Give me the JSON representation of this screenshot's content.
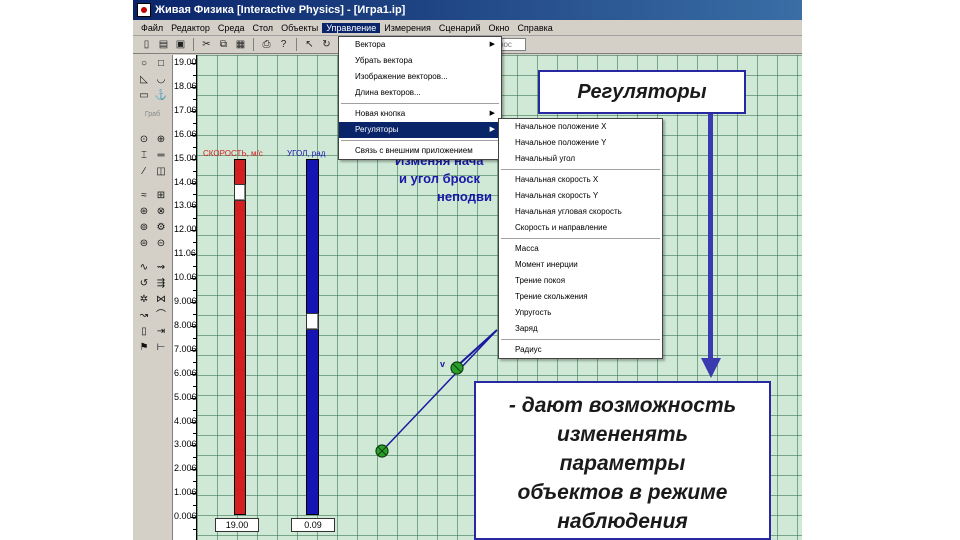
{
  "window": {
    "title": "Живая Физика [Interactive Physics] - [Игра1.ip]"
  },
  "menubar": [
    "Файл",
    "Редактор",
    "Среда",
    "Стол",
    "Объекты",
    "Управление",
    "Измерения",
    "Сценарий",
    "Окно",
    "Справка"
  ],
  "toolbar": {
    "field_text": "рос"
  },
  "left_toolbar": {
    "label": "Граб"
  },
  "ruler": {
    "labels": [
      "19.00",
      "18.06",
      "17.06",
      "16.06",
      "15.00",
      "14.06",
      "13.06",
      "12.00",
      "11.06",
      "10.06",
      "9.006",
      "8.006",
      "7.006",
      "6.006",
      "5.006",
      "4.006",
      "3.006",
      "2.006",
      "1.006",
      "0.006"
    ]
  },
  "sliders": [
    {
      "label": "СКОРОСТЬ, м/с",
      "value": "19.00",
      "level": 0.98,
      "color": "#d21f1f"
    },
    {
      "label": "УГОЛ, рад",
      "value": "0.09",
      "level": 0.6,
      "color": "#1515b4"
    }
  ],
  "canvas": {
    "overlay_text": [
      "Изменяя нача",
      "и угол броск",
      "неподви"
    ],
    "vector_label": "v"
  },
  "control_menu": {
    "items": [
      {
        "label": "Вектора",
        "submenu": true
      },
      {
        "label": "Убрать вектора",
        "submenu": false
      },
      {
        "label": "Изображение векторов...",
        "submenu": false
      },
      {
        "label": "Длина векторов...",
        "submenu": false
      },
      {
        "label": "Новая кнопка",
        "submenu": true
      },
      {
        "label": "Регуляторы",
        "submenu": true,
        "selected": true
      },
      {
        "label": "Связь с внешним приложением",
        "submenu": false
      }
    ]
  },
  "regulators_submenu": {
    "items": [
      "Начальное положение X",
      "Начальное положение Y",
      "Начальный угол",
      "Начальная скорость X",
      "Начальная скорость Y",
      "Начальная угловая скорость",
      "Скорость и направление",
      "Масса",
      "Момент инерции",
      "Трение покоя",
      "Трение скольжения",
      "Упругость",
      "Заряд",
      "Радиус"
    ]
  },
  "callouts": {
    "title": "Регуляторы",
    "description": [
      "- дают возможность",
      "измененять",
      "параметры",
      "объектов в режиме",
      "наблюдения"
    ]
  },
  "colors": {
    "callout_border": "#2828a0",
    "arrow": "#3a3ab0",
    "vector": "#1a1aa0",
    "ball": "#2aa02a"
  }
}
